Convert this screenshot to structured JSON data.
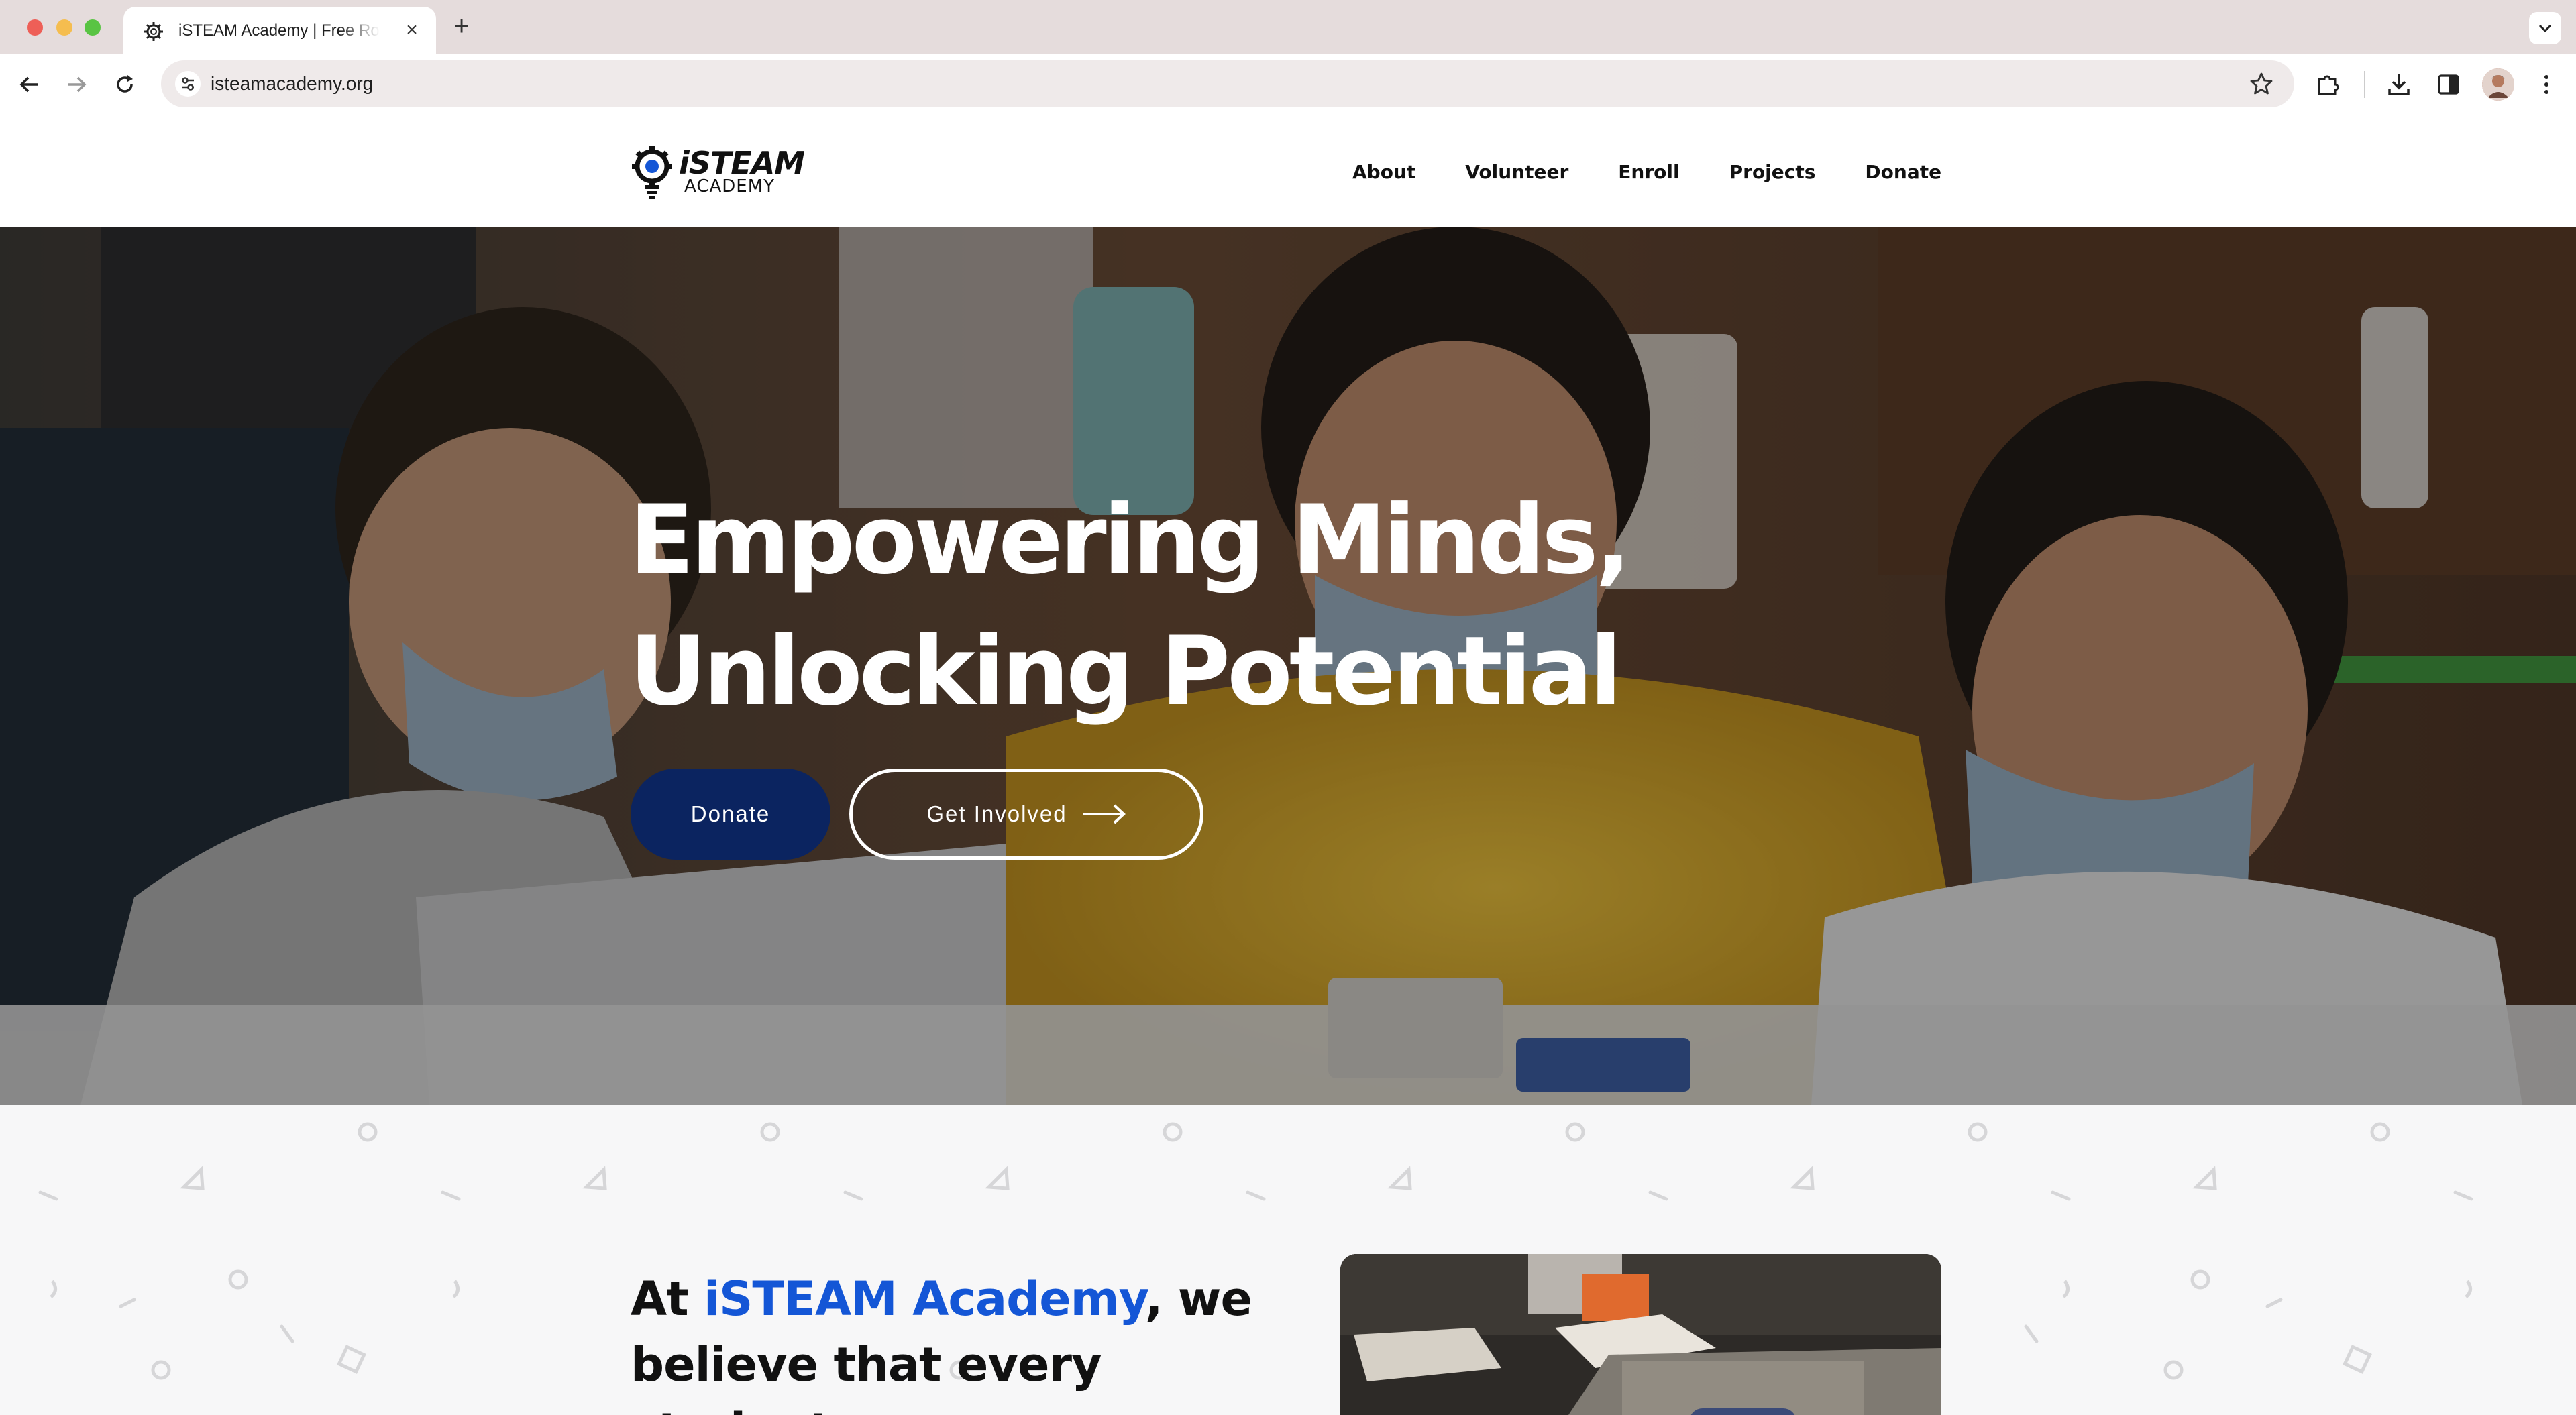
{
  "browser": {
    "tab_title": "iSTEAM Academy | Free Robotics",
    "url": "isteamacademy.org"
  },
  "site": {
    "logo_word": "iSTEAM",
    "logo_sub": "ACADEMY",
    "nav": [
      "About",
      "Volunteer",
      "Enroll",
      "Projects",
      "Donate"
    ]
  },
  "hero": {
    "title_line1": "Empowering Minds,",
    "title_line2": "Unlocking Potential",
    "donate_label": "Donate",
    "involved_label": "Get Involved"
  },
  "intro": {
    "prefix": "At ",
    "brand": "iSTEAM Academy",
    "rest_line1": ", we",
    "line2": "believe that every student"
  },
  "colors": {
    "brand_blue": "#1456d6",
    "donate_navy": "#0b2460"
  }
}
